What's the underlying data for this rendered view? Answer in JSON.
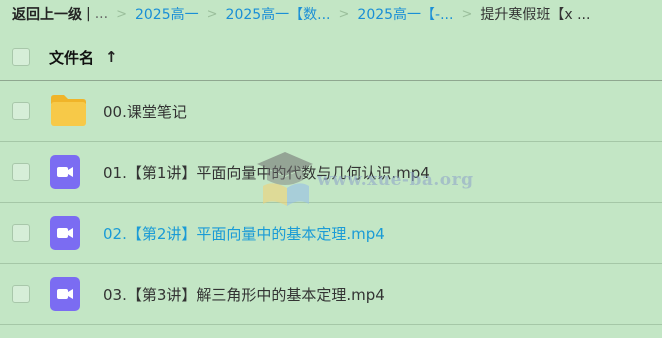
{
  "breadcrumb": {
    "back": "返回上一级",
    "bar": "|",
    "ellipsis": "...",
    "separator": ">",
    "crumb1": "2025高一",
    "crumb2": "2025高一【数...",
    "crumb3": "2025高一【-...",
    "current": "提升寒假班【x ..."
  },
  "header": {
    "column_label": "文件名",
    "sort_glyph": "↑"
  },
  "files": [
    {
      "name": "00.课堂笔记",
      "icon": "folder-icon",
      "active": false
    },
    {
      "name": "01.【第1讲】平面向量中的代数与几何认识.mp4",
      "icon": "video-icon",
      "active": false
    },
    {
      "name": "02.【第2讲】平面向量中的基本定理.mp4",
      "icon": "video-icon",
      "active": true
    },
    {
      "name": "03.【第3讲】解三角形中的基本定理.mp4",
      "icon": "video-icon",
      "active": false
    }
  ],
  "watermark": {
    "text": "www.xue-ba.org"
  },
  "colors": {
    "background": "#c3e6c5",
    "link": "#1a8fd6",
    "folder": "#f5c242",
    "video": "#7b6cf2"
  }
}
